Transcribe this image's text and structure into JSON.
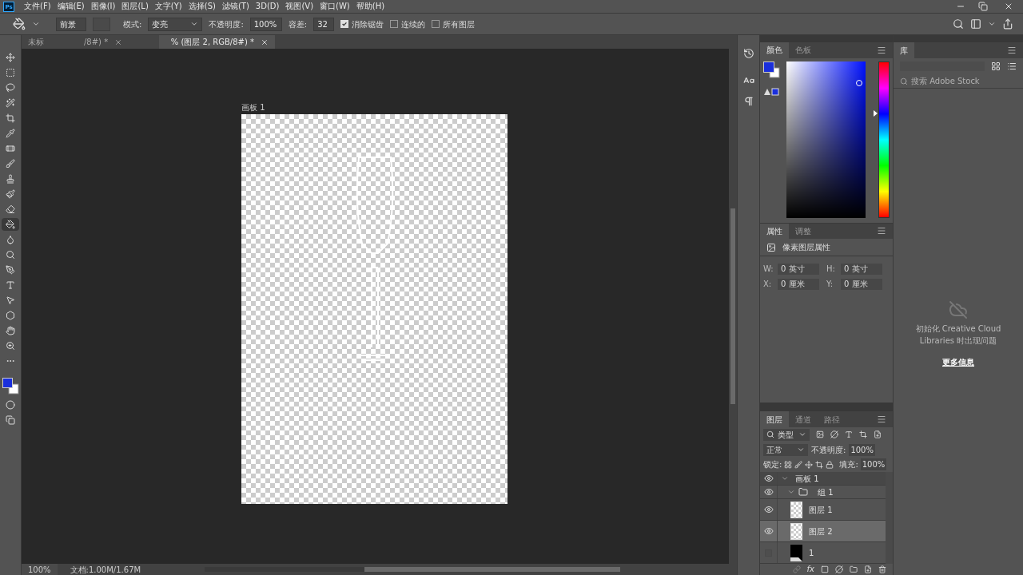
{
  "app": {
    "logo": "Ps",
    "menu": [
      "文件(F)",
      "编辑(E)",
      "图像(I)",
      "图层(L)",
      "文字(Y)",
      "选择(S)",
      "滤镜(T)",
      "3D(D)",
      "视图(V)",
      "窗口(W)",
      "帮助(H)"
    ]
  },
  "options": {
    "preset": "前景",
    "mode_label": "模式:",
    "mode": "变亮",
    "opacity_label": "不透明度:",
    "opacity": "100%",
    "tolerance_label": "容差:",
    "tolerance": "32",
    "checks": [
      {
        "label": "消除锯齿",
        "checked": true
      },
      {
        "label": "连续的",
        "checked": false
      },
      {
        "label": "所有图层",
        "checked": false
      }
    ]
  },
  "tabs": [
    {
      "label_start": "未标",
      "label_end": "/8#) *",
      "selected": false
    },
    {
      "label_end": "% (图层 2, RGB/8#) *",
      "selected": true
    }
  ],
  "tools": [
    {
      "kind": "move",
      "selected": false
    },
    {
      "kind": "marquee",
      "selected": false
    },
    {
      "kind": "lasso",
      "selected": false
    },
    {
      "kind": "wand",
      "selected": false
    },
    {
      "kind": "crop",
      "selected": false
    },
    {
      "kind": "eyedropper",
      "selected": false
    },
    {
      "kind": "heal",
      "selected": false
    },
    {
      "kind": "brush",
      "selected": false
    },
    {
      "kind": "stamp",
      "selected": false
    },
    {
      "kind": "history",
      "selected": false
    },
    {
      "kind": "eraser",
      "selected": false
    },
    {
      "kind": "bucket",
      "selected": true
    },
    {
      "kind": "blur",
      "selected": false
    },
    {
      "kind": "dodge",
      "selected": false
    },
    {
      "kind": "pen",
      "selected": false
    },
    {
      "kind": "type",
      "selected": false
    },
    {
      "kind": "select",
      "selected": false
    },
    {
      "kind": "shape",
      "selected": false
    },
    {
      "kind": "hand",
      "selected": false
    },
    {
      "kind": "zoom",
      "selected": false
    },
    {
      "kind": "more",
      "selected": false
    }
  ],
  "canvas": {
    "artboard_label": "画板 1"
  },
  "status_bar": {
    "zoom": "100%",
    "doc": "文档:1.00M/1.67M"
  },
  "color_panel": {
    "tabs": [
      {
        "label": "颜色",
        "selected": true
      },
      {
        "label": "色板",
        "selected": false
      }
    ],
    "hue": {
      "level": 0.67
    }
  },
  "properties": {
    "tabs": [
      {
        "label": "属性",
        "selected": true
      },
      {
        "label": "调整",
        "selected": false
      }
    ],
    "title": "像素图层属性",
    "fields": [
      {
        "label": "W:",
        "value": "0 英寸"
      },
      {
        "label": "H:",
        "value": "0 英寸"
      },
      {
        "label": "X:",
        "value": "0 厘米"
      },
      {
        "label": "Y:",
        "value": "0 厘米"
      }
    ]
  },
  "layers": {
    "tabs": [
      {
        "label": "图层",
        "selected": true
      },
      {
        "label": "通道",
        "selected": false
      },
      {
        "label": "路径",
        "selected": false
      }
    ],
    "filter": "类型",
    "blend": "正常",
    "opacity_label": "不透明度:",
    "opacity": "100%",
    "lock_label": "锁定:",
    "fill_label": "填充:",
    "fill": "100%",
    "fx": "fx",
    "items": [
      {
        "name": "画板 1",
        "kind": "artboard",
        "visible": true,
        "selected": false,
        "expanded": true,
        "children": [
          {
            "name": "组 1",
            "kind": "group",
            "visible": true,
            "selected": false,
            "expanded": true,
            "children": [
              {
                "name": "图层 1",
                "kind": "layer",
                "visible": true,
                "selected": false
              },
              {
                "name": "图层 2",
                "kind": "layer",
                "visible": true,
                "selected": true
              },
              {
                "name": "1",
                "kind": "smart",
                "visible": false,
                "selected": false
              }
            ]
          }
        ]
      }
    ]
  },
  "library": {
    "tab": "库",
    "search_placeholder": "搜索 Adobe Stock",
    "message": "初始化 Creative Cloud Libraries 时出现问题",
    "link": "更多信息"
  }
}
